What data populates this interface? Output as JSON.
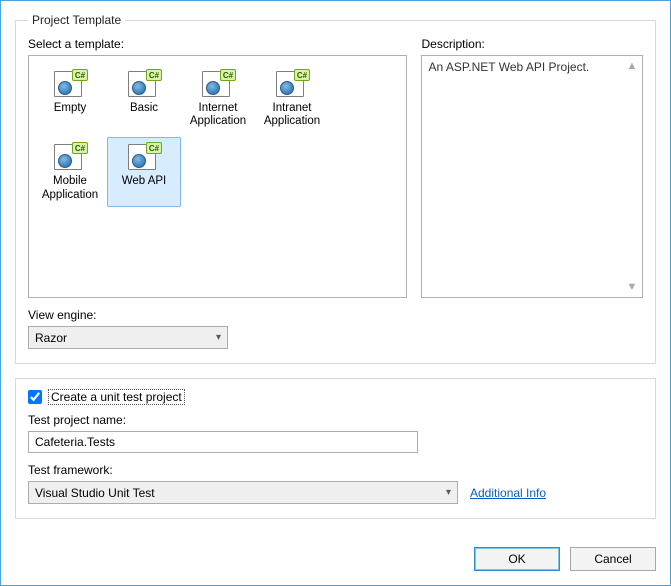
{
  "dialog": {
    "title": "Project Template"
  },
  "top": {
    "select_label": "Select a template:",
    "desc_label": "Description:",
    "description_text": "An ASP.NET Web API Project."
  },
  "templates": [
    {
      "label": "Empty"
    },
    {
      "label": "Basic"
    },
    {
      "label": "Internet Application"
    },
    {
      "label": "Intranet Application"
    },
    {
      "label": "Mobile Application"
    },
    {
      "label": "Web API"
    }
  ],
  "view_engine": {
    "label": "View engine:",
    "value": "Razor"
  },
  "unit_test": {
    "checkbox_label": "Create a unit test project",
    "project_name_label": "Test project name:",
    "project_name_value": "Cafeteria.Tests",
    "framework_label": "Test framework:",
    "framework_value": "Visual Studio Unit Test",
    "additional_info": "Additional Info"
  },
  "buttons": {
    "ok": "OK",
    "cancel": "Cancel"
  },
  "icon_badge": "C#"
}
